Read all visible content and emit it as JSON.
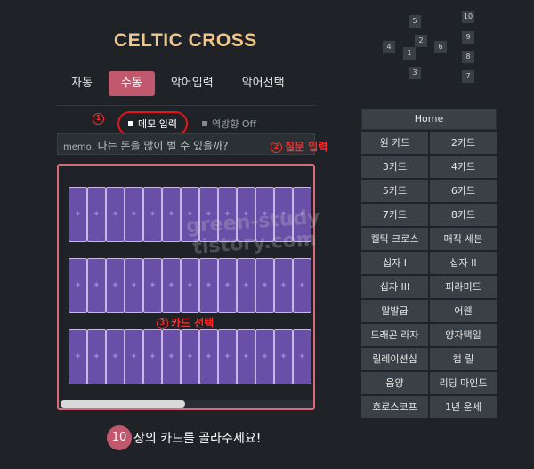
{
  "title": "CELTIC CROSS",
  "cross_positions": [
    "5",
    "10",
    "2",
    "9",
    "4",
    "1",
    "6",
    "8",
    "3",
    "7"
  ],
  "tabs": [
    {
      "label": "자동"
    },
    {
      "label": "수동"
    },
    {
      "label": "악어입력"
    },
    {
      "label": "악어선택"
    }
  ],
  "active_tab": "수동",
  "options": {
    "memo_label": "메모 입력",
    "reverse_label": "역방향 Off"
  },
  "annotations": {
    "one": {
      "num": "1"
    },
    "two": {
      "num": "2",
      "text": "질문 입력"
    },
    "three": {
      "num": "3",
      "text": "카드 선택"
    }
  },
  "memo": {
    "prefix": "memo.",
    "value": "나는 돈을 많이 벌 수 있을까?"
  },
  "watermark": {
    "line1": "green-study",
    "line2": "tistory.com"
  },
  "count": {
    "number": "10",
    "text": "장의 카드를 골라주세요!"
  },
  "colors": {
    "accent": "#c0586e",
    "card": "#6a4fa8",
    "title": "#f0c68a"
  },
  "menu": {
    "home": "Home",
    "items": [
      "원 카드",
      "2카드",
      "3카드",
      "4카드",
      "5카드",
      "6카드",
      "7카드",
      "8카드",
      "켈틱 크로스",
      "매직 세븐",
      "십자 I",
      "십자 II",
      "십자 III",
      "피라미드",
      "말발굽",
      "어웬",
      "드래곤 라자",
      "양자택일",
      "릴레이션십",
      "컵 릴",
      "음양",
      "리딩 마인드",
      "호로스코프",
      "1년 운세"
    ]
  }
}
